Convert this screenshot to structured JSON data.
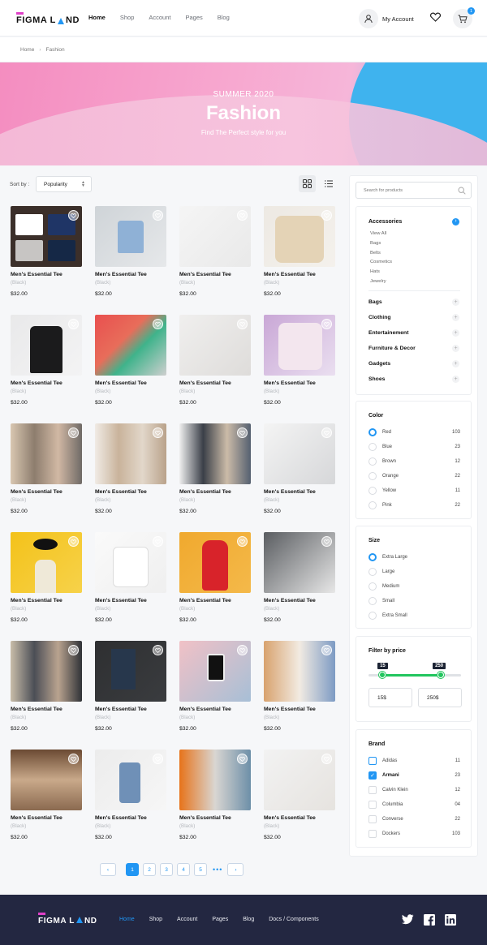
{
  "header": {
    "logo_text_1": "FIGMA L",
    "logo_text_2": "ND",
    "nav": [
      {
        "label": "Home",
        "active": true
      },
      {
        "label": "Shop",
        "active": false
      },
      {
        "label": "Account",
        "active": false
      },
      {
        "label": "Pages",
        "active": false
      },
      {
        "label": "Blog",
        "active": false
      }
    ],
    "account_label": "My Account",
    "cart_count": "1"
  },
  "breadcrumb": {
    "home": "Home",
    "current": "Fashion"
  },
  "hero": {
    "season": "SUMMER 2020",
    "title": "Fashion",
    "tagline": "Find The Perfect style for you"
  },
  "toolbar": {
    "sort_label": "Sort by :",
    "sort_value": "Popularity"
  },
  "products": [
    {
      "name": "Men's Essential Tee",
      "color": "(Black)",
      "price": "$32.00",
      "img": "folded-shirts"
    },
    {
      "name": "Men's Essential Tee",
      "color": "(Black)",
      "price": "$32.00",
      "img": "hanging-tee"
    },
    {
      "name": "Men's Essential Tee",
      "color": "(Black)",
      "price": "$32.00",
      "img": "outfit-flatlay"
    },
    {
      "name": "Men's Essential Tee",
      "color": "(Black)",
      "price": "$32.00",
      "img": "knit-sweater"
    },
    {
      "name": "Men's Essential Tee",
      "color": "(Black)",
      "price": "$32.00",
      "img": "black-blazer"
    },
    {
      "name": "Men's Essential Tee",
      "color": "(Black)",
      "price": "$32.00",
      "img": "colored-polos"
    },
    {
      "name": "Men's Essential Tee",
      "color": "(Black)",
      "price": "$32.00",
      "img": "jeans-flatlay"
    },
    {
      "name": "Men's Essential Tee",
      "color": "(Black)",
      "price": "$32.00",
      "img": "love-will-save-us-tee"
    },
    {
      "name": "Men's Essential Tee",
      "color": "(Black)",
      "price": "$32.00",
      "img": "clothing-rack"
    },
    {
      "name": "Men's Essential Tee",
      "color": "(Black)",
      "price": "$32.00",
      "img": "beige-rack"
    },
    {
      "name": "Men's Essential Tee",
      "color": "(Black)",
      "price": "$32.00",
      "img": "dark-rack"
    },
    {
      "name": "Men's Essential Tee",
      "color": "(Black)",
      "price": "$32.00",
      "img": "jeans-flatlay-2"
    },
    {
      "name": "Men's Essential Tee",
      "color": "(Black)",
      "price": "$32.00",
      "img": "yellow-hat-woman"
    },
    {
      "name": "Men's Essential Tee",
      "color": "(Black)",
      "price": "$32.00",
      "img": "white-tee-woman"
    },
    {
      "name": "Men's Essential Tee",
      "color": "(Black)",
      "price": "$32.00",
      "img": "red-dress"
    },
    {
      "name": "Men's Essential Tee",
      "color": "(Black)",
      "price": "$32.00",
      "img": "room-rack"
    },
    {
      "name": "Men's Essential Tee",
      "color": "(Black)",
      "price": "$32.00",
      "img": "store-racks"
    },
    {
      "name": "Men's Essential Tee",
      "color": "(Black)",
      "price": "$32.00",
      "img": "dark-jeans-shoes"
    },
    {
      "name": "Men's Essential Tee",
      "color": "(Black)",
      "price": "$32.00",
      "img": "phone-jeans"
    },
    {
      "name": "Men's Essential Tee",
      "color": "(Black)",
      "price": "$32.00",
      "img": "shirts-denim"
    },
    {
      "name": "Men's Essential Tee",
      "color": "(Black)",
      "price": "$32.00",
      "img": "shelf-clothes"
    },
    {
      "name": "Men's Essential Tee",
      "color": "(Black)",
      "price": "$32.00",
      "img": "denim-jacket"
    },
    {
      "name": "Men's Essential Tee",
      "color": "(Black)",
      "price": "$32.00",
      "img": "hand-pocket"
    },
    {
      "name": "Men's Essential Tee",
      "color": "(Black)",
      "price": "$32.00",
      "img": "flatlay-shoes"
    }
  ],
  "pagination": {
    "pages": [
      "1",
      "2",
      "3",
      "4",
      "5"
    ],
    "current": "1",
    "ellipsis": "•••"
  },
  "sidebar": {
    "search_placeholder": "Search for products",
    "categories": {
      "main": "Accessories",
      "sub": [
        "View All",
        "Bags",
        "Belts",
        "Cosmetics",
        "Hats",
        "Jewelry"
      ],
      "others": [
        "Bags",
        "Clothing",
        "Entertainement",
        "Furniture & Decor",
        "Gadgets",
        "Shoes"
      ]
    },
    "color": {
      "title": "Color",
      "options": [
        {
          "label": "Red",
          "count": "103",
          "selected": true
        },
        {
          "label": "Blue",
          "count": "23",
          "selected": false
        },
        {
          "label": "Brown",
          "count": "12",
          "selected": false
        },
        {
          "label": "Orange",
          "count": "22",
          "selected": false
        },
        {
          "label": "Yellow",
          "count": "11",
          "selected": false
        },
        {
          "label": "Pink",
          "count": "22",
          "selected": false
        }
      ]
    },
    "size": {
      "title": "Size",
      "options": [
        {
          "label": "Extra Large",
          "selected": true
        },
        {
          "label": "Large",
          "selected": false
        },
        {
          "label": "Medium",
          "selected": false
        },
        {
          "label": "Small",
          "selected": false
        },
        {
          "label": "Extra Small",
          "selected": false
        }
      ]
    },
    "price": {
      "title": "Filter by price",
      "min_tip": "15",
      "max_tip": "250",
      "min_input": "15$",
      "max_input": "250$",
      "min_value": 15,
      "max_value": 250,
      "range_max": 320
    },
    "brand": {
      "title": "Brand",
      "options": [
        {
          "label": "Adidas",
          "count": "11",
          "checked": false
        },
        {
          "label": "Armani",
          "count": "23",
          "checked": true
        },
        {
          "label": "Calvin Klein",
          "count": "12",
          "checked": false
        },
        {
          "label": "Columbia",
          "count": "04",
          "checked": false
        },
        {
          "label": "Converse",
          "count": "22",
          "checked": false
        },
        {
          "label": "Dockers",
          "count": "103",
          "checked": false
        }
      ]
    }
  },
  "footer": {
    "logo_text_1": "FIGMA L",
    "logo_text_2": "ND",
    "nav": [
      {
        "label": "Home",
        "active": true
      },
      {
        "label": "Shop",
        "active": false
      },
      {
        "label": "Account",
        "active": false
      },
      {
        "label": "Pages",
        "active": false
      },
      {
        "label": "Blog",
        "active": false
      },
      {
        "label": "Docs / Components",
        "active": false
      }
    ],
    "social": [
      "twitter-icon",
      "facebook-icon",
      "linkedin-icon"
    ]
  },
  "colors": {
    "accent": "#2196f3",
    "slider": "#22c55e",
    "footer_bg": "#232741",
    "logo_pink": "#e040c8"
  }
}
